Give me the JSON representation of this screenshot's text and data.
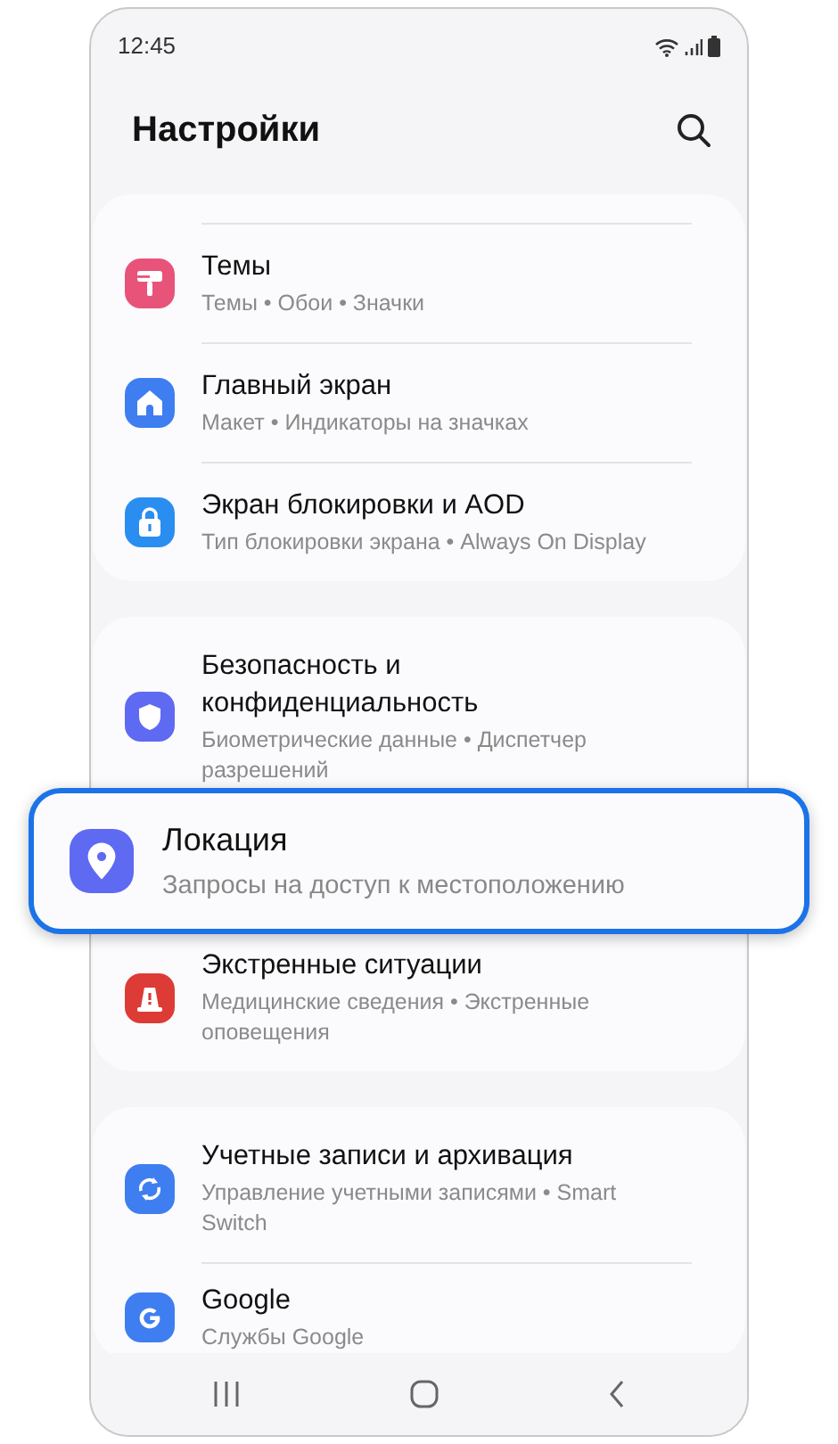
{
  "status_bar": {
    "time": "12:45"
  },
  "header": {
    "title": "Настройки"
  },
  "groups": [
    {
      "items": [
        {
          "kind": "brush",
          "color": "#e8537a",
          "title": "Темы",
          "subtitle": "Темы • Обои • Значки",
          "highlighted": false
        },
        {
          "kind": "home",
          "color": "#3f7ef0",
          "title": "Главный экран",
          "subtitle": "Макет • Индикаторы на значках",
          "highlighted": false
        },
        {
          "kind": "lock",
          "color": "#2a8ef0",
          "title": "Экран блокировки и AOD",
          "subtitle": "Тип блокировки экрана • Always On Display",
          "highlighted": false
        }
      ]
    },
    {
      "items": [
        {
          "kind": "shield",
          "color": "#5e6af2",
          "title": "Безопасность и конфиденциальность",
          "subtitle": "Биометрические данные • Диспетчер разрешений",
          "highlighted": false
        },
        {
          "kind": "pin",
          "color": "#5e6af2",
          "title": "Локация",
          "subtitle": "Запросы на доступ к местоположению",
          "highlighted": true
        },
        {
          "kind": "alert",
          "color": "#dd3b35",
          "title": "Экстренные ситуации",
          "subtitle": "Медицинские сведения • Экстренные оповещения",
          "highlighted": false
        }
      ]
    },
    {
      "items": [
        {
          "kind": "sync",
          "color": "#3f7ef0",
          "title": "Учетные записи и архивация",
          "subtitle": "Управление учетными записями • Smart Switch",
          "highlighted": false
        },
        {
          "kind": "google",
          "color": "#3f7ef0",
          "title": "Google",
          "subtitle": "Службы Google",
          "highlighted": false
        }
      ]
    }
  ]
}
